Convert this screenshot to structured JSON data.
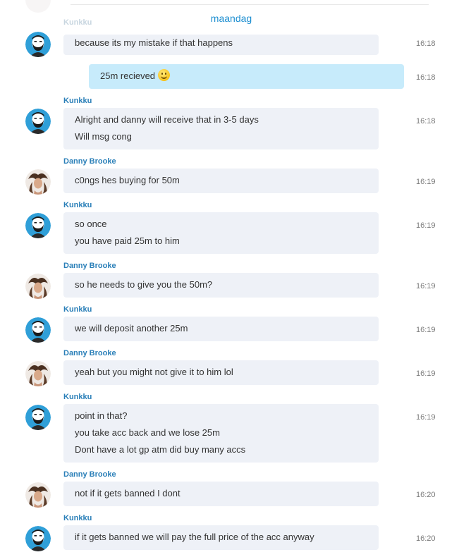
{
  "date_divider": "maandag",
  "partial_sender": "Kunkku",
  "colors": {
    "accent": "#1e8fd1",
    "sender": "#2a7fb8",
    "bubble": "#eef1f7",
    "own_bubble": "#c7ebfb"
  },
  "messages": [
    {
      "lines": [
        "because its my mistake if that happens"
      ],
      "time": "16:18"
    },
    {
      "lines": [
        "25m recieved"
      ],
      "emoji": "smile",
      "time": "16:18"
    },
    {
      "sender": "Kunkku",
      "lines": [
        "Alright and danny will receive that in 3-5 days",
        "Will msg cong"
      ],
      "time": "16:18"
    },
    {
      "sender": "Danny Brooke",
      "lines": [
        "c0ngs hes buying for 50m"
      ],
      "time": "16:19"
    },
    {
      "sender": "Kunkku",
      "lines": [
        "so once",
        "you have paid 25m to him"
      ],
      "time": "16:19"
    },
    {
      "sender": "Danny Brooke",
      "lines": [
        "so he needs to give you the 50m?"
      ],
      "time": "16:19"
    },
    {
      "sender": "Kunkku",
      "lines": [
        "we will deposit another 25m"
      ],
      "time": "16:19"
    },
    {
      "sender": "Danny Brooke",
      "lines": [
        "yeah but you might not give it to him lol"
      ],
      "time": "16:19"
    },
    {
      "sender": "Kunkku",
      "lines": [
        "point in that?",
        "you take acc back and we lose 25m",
        "Dont have a lot gp atm did buy many accs"
      ],
      "time": "16:19"
    },
    {
      "sender": "Danny Brooke",
      "lines": [
        "not if it gets banned I dont"
      ],
      "time": "16:20"
    },
    {
      "sender": "Kunkku",
      "lines": [
        "if it gets banned we will pay the full price of the acc anyway"
      ],
      "time": "16:20"
    }
  ]
}
